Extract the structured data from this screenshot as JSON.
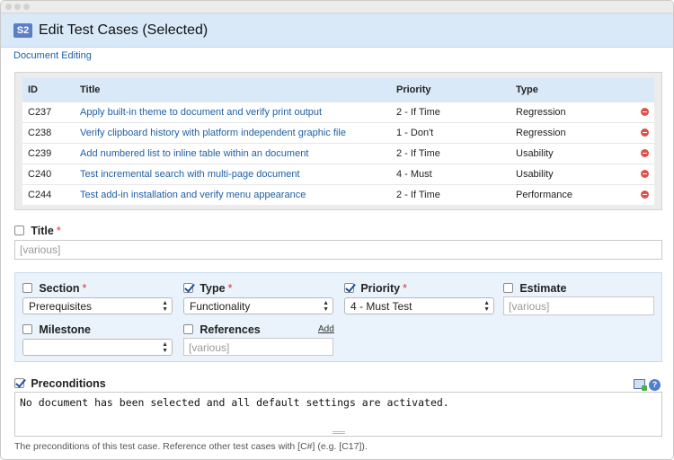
{
  "header": {
    "badge": "S2",
    "title": "Edit Test Cases (Selected)"
  },
  "breadcrumb": "Document Editing",
  "cases_table": {
    "columns": [
      "ID",
      "Title",
      "Priority",
      "Type"
    ],
    "rows": [
      {
        "id": "C237",
        "title": "Apply built-in theme to document and verify print output",
        "priority": "2 - If Time",
        "type": "Regression"
      },
      {
        "id": "C238",
        "title": "Verify clipboard history with platform independent graphic file",
        "priority": "1 - Don't",
        "type": "Regression"
      },
      {
        "id": "C239",
        "title": "Add numbered list to inline table within an document",
        "priority": "2 - If Time",
        "type": "Usability"
      },
      {
        "id": "C240",
        "title": "Test incremental search with multi-page document",
        "priority": "4 - Must",
        "type": "Usability"
      },
      {
        "id": "C244",
        "title": "Test add-in installation and verify menu appearance",
        "priority": "2 - If Time",
        "type": "Performance"
      }
    ],
    "delete_icon": "remove-icon"
  },
  "title_field": {
    "label": "Title",
    "required": "*",
    "placeholder": "[various]",
    "checked": false
  },
  "section_field": {
    "label": "Section",
    "required": "*",
    "value": "Prerequisites",
    "checked": false
  },
  "type_field": {
    "label": "Type",
    "required": "*",
    "value": "Functionality",
    "checked": true
  },
  "priority_field": {
    "label": "Priority",
    "required": "*",
    "value": "4 - Must Test",
    "checked": true
  },
  "estimate_field": {
    "label": "Estimate",
    "placeholder": "[various]",
    "checked": false
  },
  "milestone_field": {
    "label": "Milestone",
    "value": "",
    "checked": false
  },
  "references_field": {
    "label": "References",
    "add_label": "Add",
    "placeholder": "[various]",
    "checked": false
  },
  "preconditions": {
    "label": "Preconditions",
    "checked": true,
    "text": "No document has been selected and all default settings are activated.",
    "help": "The preconditions of this test case. Reference other test cases with [C#] (e.g. [C17]).",
    "icons": [
      "editor-icon",
      "help-icon"
    ]
  },
  "colors": {
    "header_bg": "#d9e9f7",
    "badge": "#5b7fc3",
    "link": "#1f5fa8",
    "required": "#dd3333",
    "delete": "#e0504a"
  }
}
